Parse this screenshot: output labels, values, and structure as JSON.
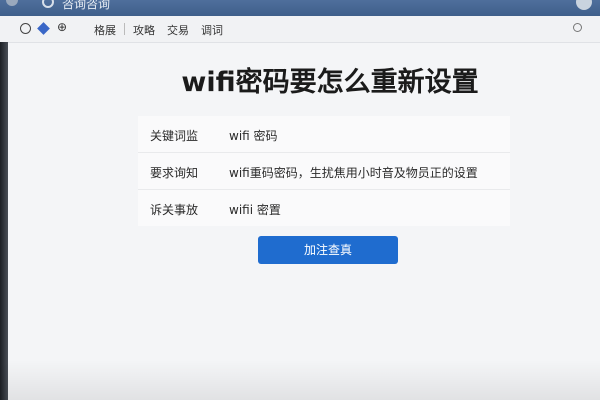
{
  "window": {
    "title": "咨询咨询"
  },
  "toolbar": {
    "item_format": "格展",
    "item_strategy": "攻略",
    "item_trade": "交易",
    "item_words": "调词"
  },
  "main": {
    "title": "wifi密码要怎么重新设置",
    "rows": [
      {
        "label": "关键词监",
        "value": "wifi  密码"
      },
      {
        "label": "要求询知",
        "value": "wifi重码密码，生扰焦用小时音及物员正的设置"
      },
      {
        "label": "诉关事放",
        "value": "wifii  密置"
      }
    ],
    "button_label": "加注查真"
  },
  "colors": {
    "accent": "#1f6ccf",
    "titlebar": "#4a6a96"
  },
  "icons": [
    "app-icon",
    "diamond-icon",
    "network-icon",
    "search-icon"
  ]
}
